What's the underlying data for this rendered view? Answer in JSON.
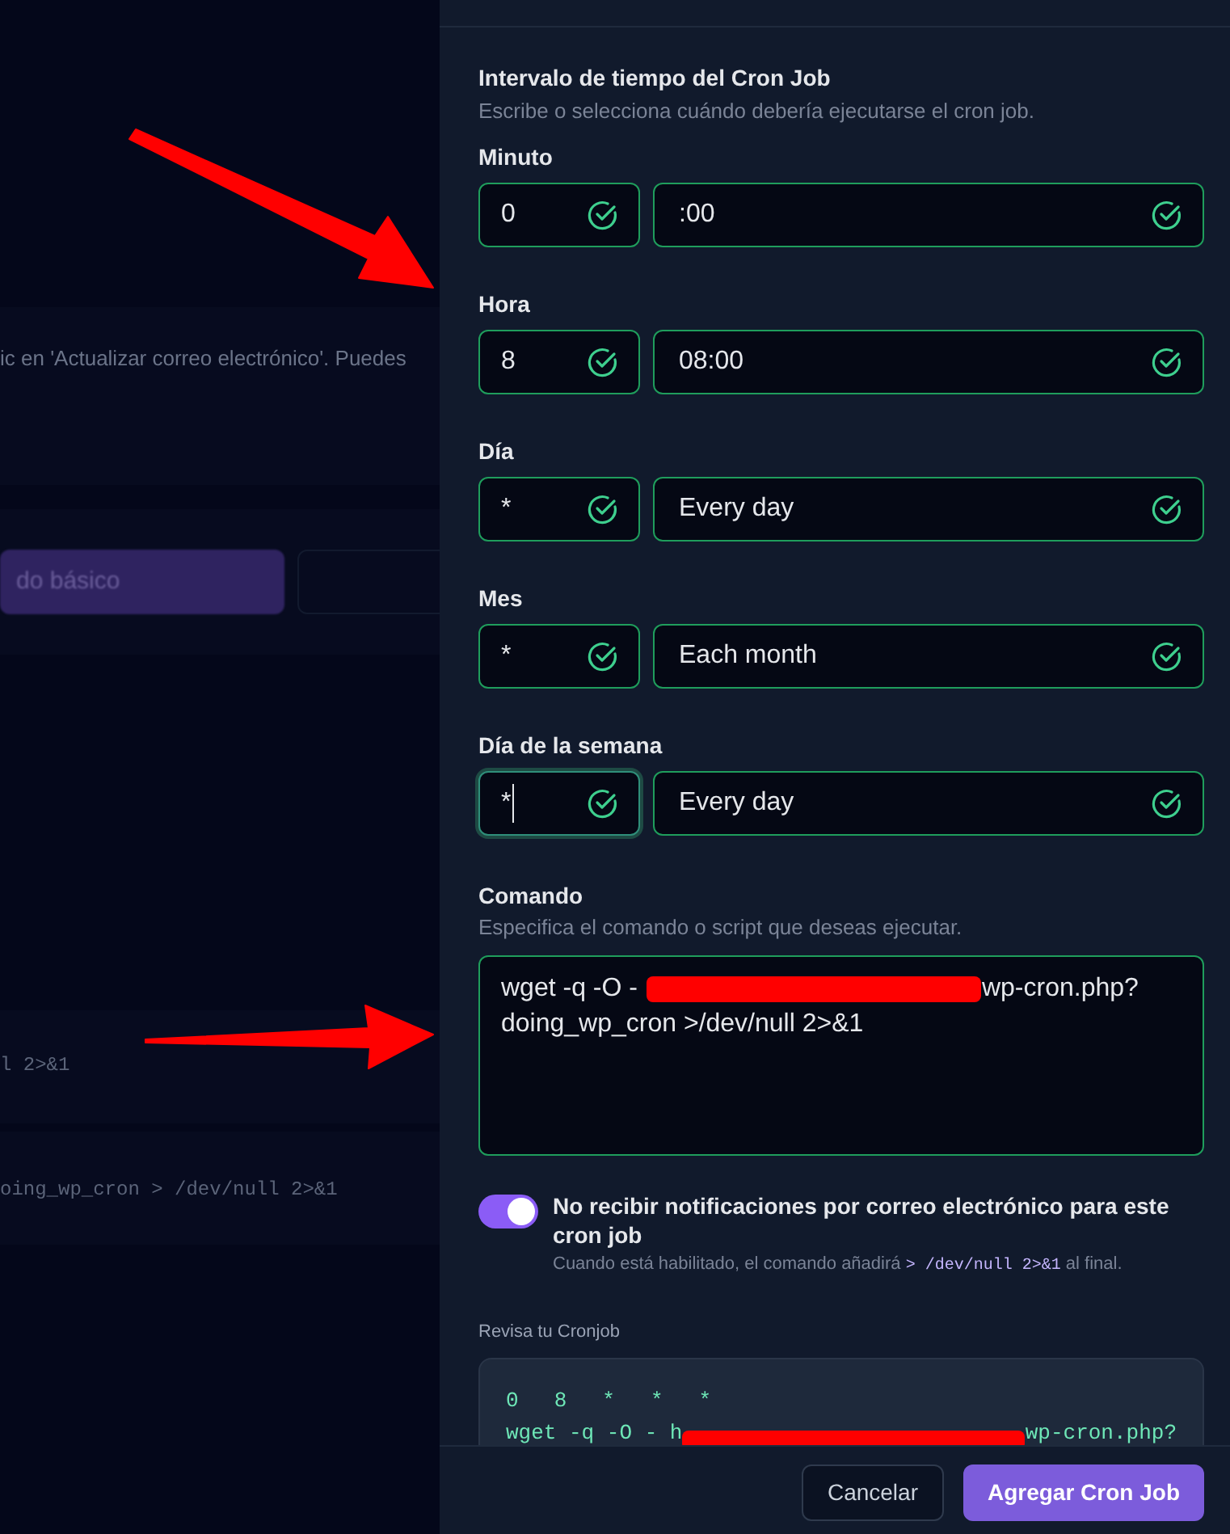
{
  "background": {
    "texts": [
      "ic en 'Actualizar correo electrónico'. Puedes",
      "l 2>&1",
      "oing_wp_cron > /dev/null 2>&1"
    ],
    "button": "do básico"
  },
  "section": {
    "title": "Intervalo de tiempo del Cron Job",
    "subtitle": "Escribe o selecciona cuándo debería ejecutarse el cron job."
  },
  "fields": [
    {
      "label": "Minuto",
      "value": "0",
      "preset": ":00",
      "valid": true,
      "focused": false
    },
    {
      "label": "Hora",
      "value": "8",
      "preset": "08:00",
      "valid": true,
      "focused": false
    },
    {
      "label": "Día",
      "value": "*",
      "preset": "Every day",
      "valid": true,
      "focused": false
    },
    {
      "label": "Mes",
      "value": "*",
      "preset": "Each month",
      "valid": true,
      "focused": false
    },
    {
      "label": "Día de la semana",
      "value": "*",
      "preset": "Every day",
      "valid": true,
      "focused": true
    }
  ],
  "command": {
    "label": "Comando",
    "subtitle": "Especifica el comando o script que deseas ejecutar.",
    "before": "wget -q -O -",
    "after": "wp-cron.php?",
    "line2": "doing_wp_cron >/dev/null 2>&1",
    "redacted": true
  },
  "toggle": {
    "label": "No recibir notificaciones por correo electrónico para este cron job",
    "on": true,
    "help_before": "Cuando está habilitado, el comando añadirá",
    "help_code": "> /dev/null 2>&1",
    "help_after": "al final."
  },
  "review": {
    "label": "Revisa tu Cronjob",
    "schedule": [
      "0",
      "8",
      "*",
      "*",
      "*"
    ],
    "before": "wget -q -O - h",
    "after": "wp-cron.php?"
  },
  "buttons": [
    {
      "label": "Cancelar",
      "kind": "secondary"
    },
    {
      "label": "Agregar Cron Job",
      "kind": "primary"
    }
  ],
  "annotations": [
    {
      "kind": "arrow"
    },
    {
      "kind": "arrow"
    }
  ]
}
